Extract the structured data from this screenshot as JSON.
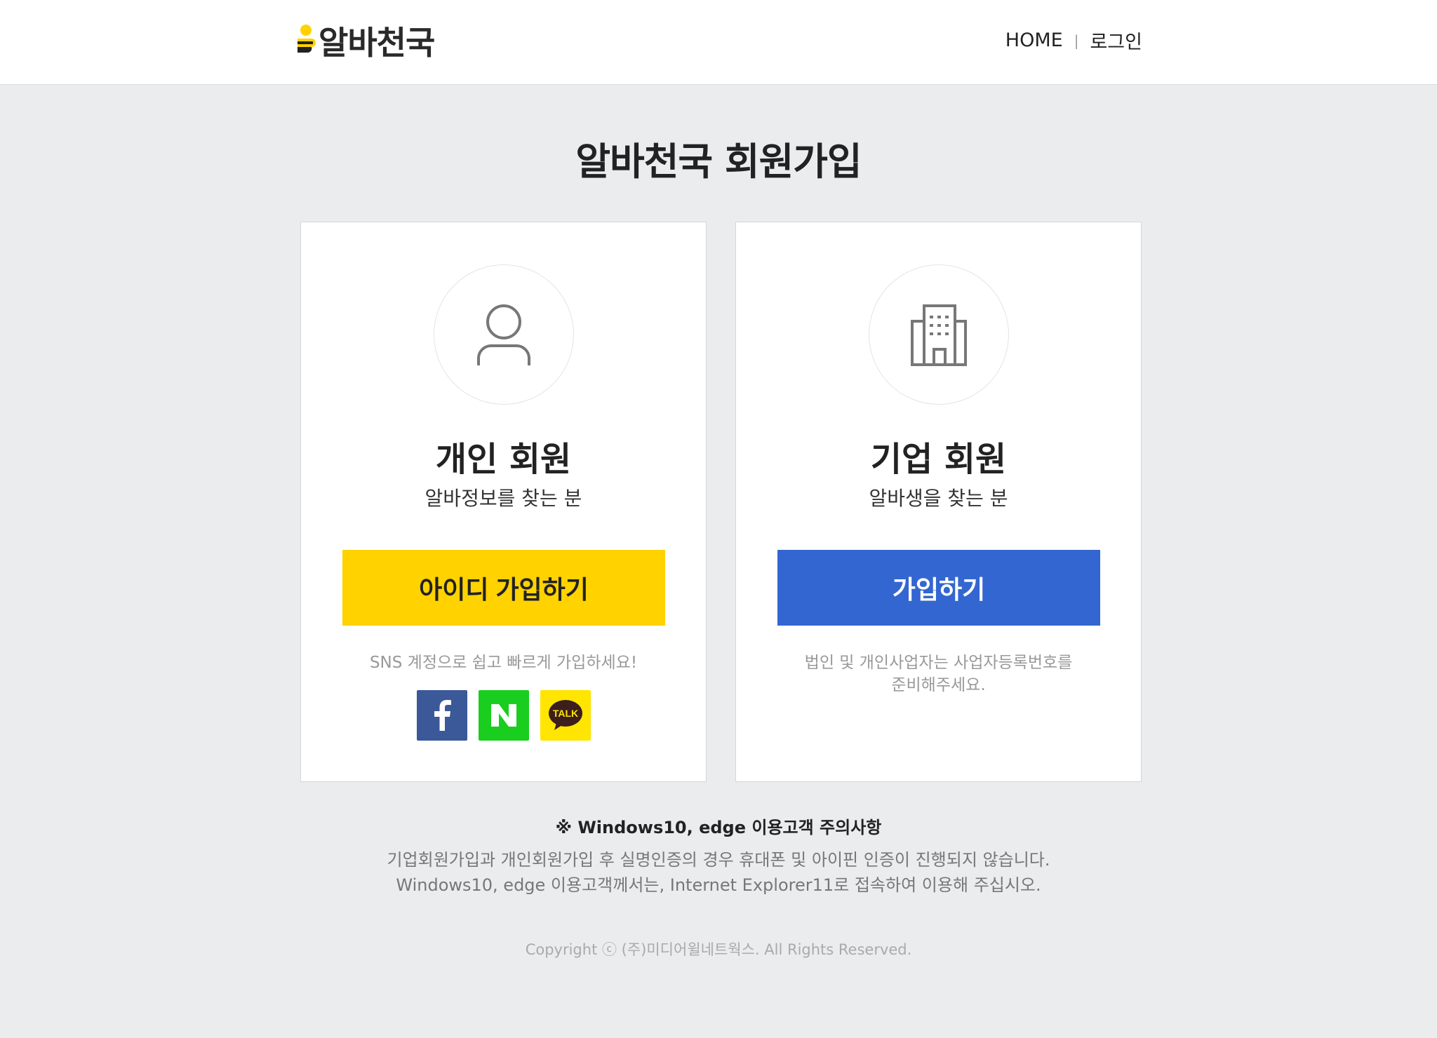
{
  "header": {
    "logo_text": "알바천국",
    "nav": {
      "home": "HOME",
      "separator": "|",
      "login": "로그인"
    }
  },
  "page": {
    "title": "알바천국 회원가입"
  },
  "personal": {
    "icon": "user-icon",
    "title": "개인 회원",
    "subtitle": "알바정보를 찾는 분",
    "button_label": "아이디 가입하기",
    "sns_note": "SNS 계정으로 쉽고 빠르게 가입하세요!",
    "sns": [
      {
        "name": "facebook",
        "label": "f",
        "color": "#3b5998"
      },
      {
        "name": "naver",
        "label": "N",
        "color": "#19ce1e"
      },
      {
        "name": "kakao",
        "label": "TALK",
        "color": "#ffe500"
      }
    ]
  },
  "business": {
    "icon": "building-icon",
    "title": "기업 회원",
    "subtitle": "알바생을 찾는 분",
    "button_label": "가입하기",
    "note_line1": "법인 및 개인사업자는 사업자등록번호를",
    "note_line2": "준비해주세요."
  },
  "notice": {
    "title": "※ Windows10, edge 이용고객 주의사항",
    "line1": "기업회원가입과 개인회원가입 후 실명인증의 경우 휴대폰 및 아이핀 인증이 진행되지 않습니다.",
    "line2": "Windows10, edge 이용고객께서는, Internet Explorer11로 접속하여 이용해 주십시오."
  },
  "footer": {
    "copyright": "Copyright ⓒ (주)미디어윌네트웍스. All Rights Reserved."
  },
  "colors": {
    "accent_yellow": "#ffd200",
    "accent_blue": "#3366d0",
    "background": "#ebecee"
  }
}
